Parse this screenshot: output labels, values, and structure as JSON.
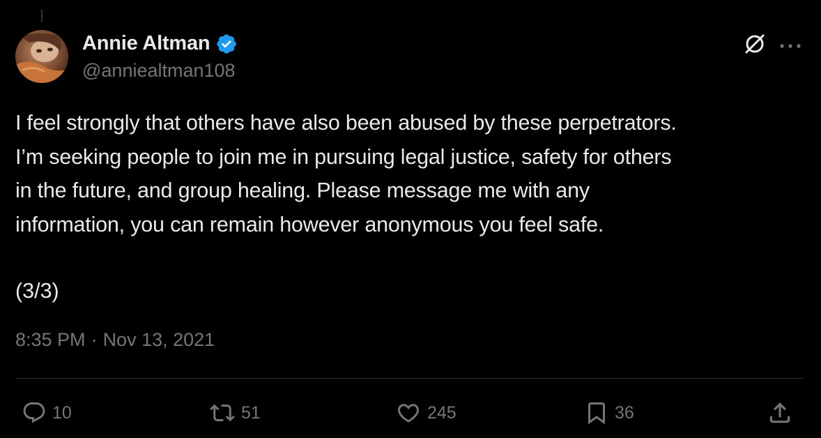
{
  "author": {
    "display_name": "Annie Altman",
    "handle": "@anniealtman108",
    "verified": true
  },
  "tweet": {
    "text": "I feel strongly that others have also been abused by these perpetrators.\nI’m seeking people to join me in pursuing legal justice, safety for others\nin the future, and group healing. Please message me with any\ninformation, you can remain however anonymous you feel safe.",
    "thread_marker": "(3/3)",
    "time": "8:35 PM",
    "separator": "·",
    "date": "Nov 13, 2021"
  },
  "actions": {
    "replies": "10",
    "reposts": "51",
    "likes": "245",
    "bookmarks": "36"
  },
  "colors": {
    "background": "#000000",
    "text_primary": "#e7e9ea",
    "text_secondary": "#71767b",
    "verified_blue": "#1d9bf0",
    "divider": "#2f3336"
  },
  "icons": {
    "verified": "verified-badge-icon",
    "grok": "grok-icon",
    "more": "more-icon",
    "reply": "reply-icon",
    "repost": "repost-icon",
    "like": "heart-icon",
    "bookmark": "bookmark-icon",
    "share": "share-icon"
  }
}
